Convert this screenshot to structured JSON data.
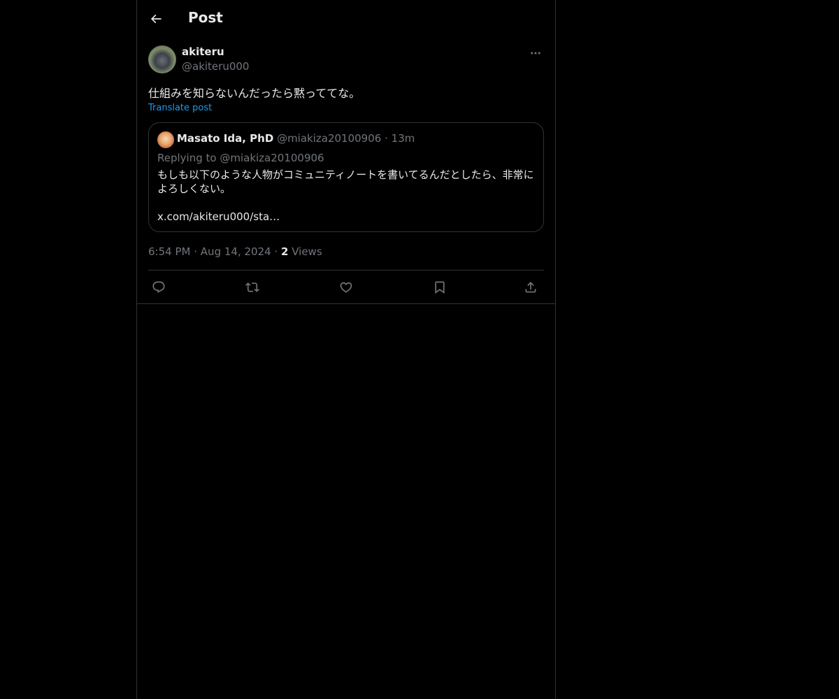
{
  "header": {
    "back_icon": "arrow-left-icon",
    "title": "Post"
  },
  "post": {
    "author_name": "akiteru",
    "author_handle": "@akiteru000",
    "more_icon": "more-horizontal-icon",
    "text": "仕組みを知らないんだったら黙っててな。",
    "translate_label": "Translate post",
    "quote": {
      "author_name": "Masato Ida, PhD",
      "author_handle": "@miakiza20100906",
      "separator": "·",
      "time": "13m",
      "replying_prefix": "Replying to",
      "replying_handle": "@miakiza20100906",
      "body": "もしも以下のような人物がコミュニティノートを書いてるんだとしたら、非常によろしくない。",
      "link": "x.com/akiteru000/sta…"
    },
    "time": "6:54 PM",
    "dot": "·",
    "date": "Aug 14, 2024",
    "views_count": "2",
    "views_label": "Views"
  },
  "actions": {
    "reply_icon": "reply-icon",
    "repost_icon": "repost-icon",
    "like_icon": "heart-icon",
    "bookmark_icon": "bookmark-icon",
    "share_icon": "share-icon"
  },
  "colors": {
    "background": "#000000",
    "text_primary": "#e7e9ea",
    "text_secondary": "#71767b",
    "accent": "#1d9bf0",
    "border": "#2f3336"
  }
}
